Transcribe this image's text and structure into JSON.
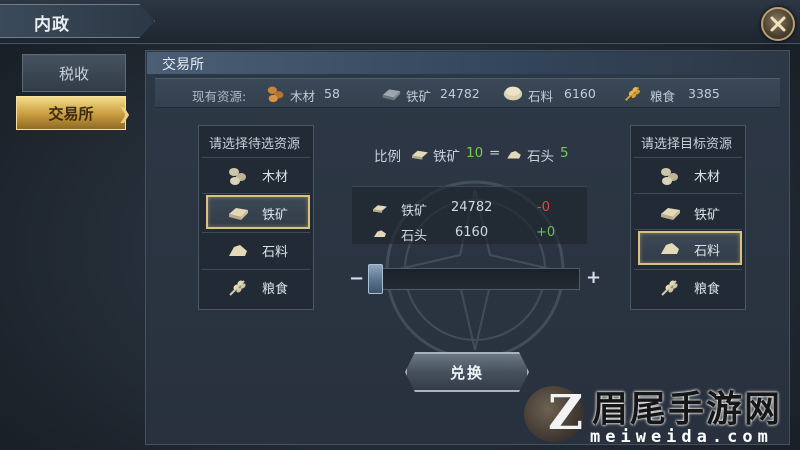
{
  "window": {
    "title": "内政",
    "close_icon": "close-icon"
  },
  "sidebar": {
    "items": [
      {
        "label": "税收",
        "active": false
      },
      {
        "label": "交易所",
        "active": true
      }
    ]
  },
  "panel": {
    "title": "交易所"
  },
  "resources": {
    "label": "现有资源:",
    "items": [
      {
        "name": "木材",
        "value": "58",
        "icon": "wood-icon"
      },
      {
        "name": "铁矿",
        "value": "24782",
        "icon": "iron-icon"
      },
      {
        "name": "石料",
        "value": "6160",
        "icon": "stone-icon"
      },
      {
        "name": "粮食",
        "value": "3385",
        "icon": "grain-icon"
      }
    ]
  },
  "source_select": {
    "title": "请选择待选资源",
    "options": [
      {
        "label": "木材",
        "icon": "wood-icon",
        "selected": false
      },
      {
        "label": "铁矿",
        "icon": "iron-icon",
        "selected": true
      },
      {
        "label": "石料",
        "icon": "stone-icon",
        "selected": false
      },
      {
        "label": "粮食",
        "icon": "grain-icon",
        "selected": false
      }
    ]
  },
  "target_select": {
    "title": "请选择目标资源",
    "options": [
      {
        "label": "木材",
        "icon": "wood-icon",
        "selected": false
      },
      {
        "label": "铁矿",
        "icon": "iron-icon",
        "selected": false
      },
      {
        "label": "石料",
        "icon": "stone-icon",
        "selected": true
      },
      {
        "label": "粮食",
        "icon": "grain-icon",
        "selected": false
      }
    ]
  },
  "ratio": {
    "label": "比例",
    "from_name": "铁矿",
    "from_amount": "10",
    "equals": "=",
    "to_name": "石头",
    "to_amount": "5"
  },
  "trade": {
    "rows": [
      {
        "name": "铁矿",
        "amount": "24782",
        "delta": "-0"
      },
      {
        "name": "石头",
        "amount": "6160",
        "delta": "+0"
      }
    ]
  },
  "slider": {
    "minus": "−",
    "plus": "+",
    "value_fraction": 0
  },
  "exchange_button": "兑换",
  "watermark": {
    "title": "眉尾手游网",
    "url": "meiweida.com"
  },
  "colors": {
    "accent_gold": "#d8c27d",
    "positive": "#6fc055",
    "negative": "#e04848",
    "ratio_number": "#79c95a"
  }
}
